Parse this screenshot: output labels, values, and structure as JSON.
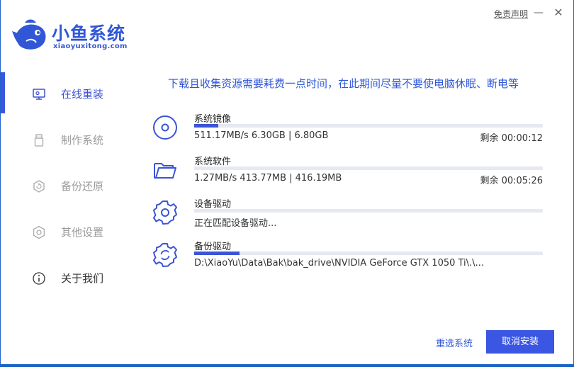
{
  "window": {
    "disclaimer": "免责声明",
    "minimize_glyph": "—",
    "close_glyph": "✕"
  },
  "logo": {
    "title": "小鱼系统",
    "subtitle": "xiaoyuxitong.com"
  },
  "sidebar": {
    "items": [
      {
        "label": "在线重装",
        "icon": "monitor-icon",
        "state": "active"
      },
      {
        "label": "制作系统",
        "icon": "usb-drive-icon",
        "state": "disabled"
      },
      {
        "label": "备份还原",
        "icon": "backup-icon",
        "state": "disabled"
      },
      {
        "label": "其他设置",
        "icon": "gear-icon",
        "state": "disabled"
      },
      {
        "label": "关于我们",
        "icon": "info-icon",
        "state": "normal"
      }
    ]
  },
  "main": {
    "notice": "下载且收集资源需要耗费一点时间，在此期间尽量不要使电脑休眠、断电等",
    "tasks": [
      {
        "name": "系统镜像",
        "detail": "511.17MB/s 6.30GB | 6.80GB",
        "remaining": "剩余 00:00:12",
        "progress": 0.07,
        "icon": "disc-icon"
      },
      {
        "name": "系统软件",
        "detail": "1.27MB/s 413.77MB | 416.19MB",
        "remaining": "剩余 00:05:26",
        "progress": 0.0,
        "icon": "folder-icon"
      },
      {
        "name": "设备驱动",
        "detail": "正在匹配设备驱动...",
        "remaining": "",
        "progress": 0.0,
        "icon": "gear-icon"
      },
      {
        "name": "备份驱动",
        "detail": "D:\\XiaoYu\\Data\\Bak\\bak_drive\\NVIDIA GeForce GTX 1050 Ti\\.\\...",
        "remaining": "",
        "progress": 0.13,
        "icon": "sync-gear-icon"
      }
    ]
  },
  "footer": {
    "reselect_label": "重选系统",
    "cancel_label": "取消安装"
  },
  "colors": {
    "accent": "#3a56e0",
    "titlebar": "#0e5db9",
    "progress_track": "#e6e8f3"
  }
}
